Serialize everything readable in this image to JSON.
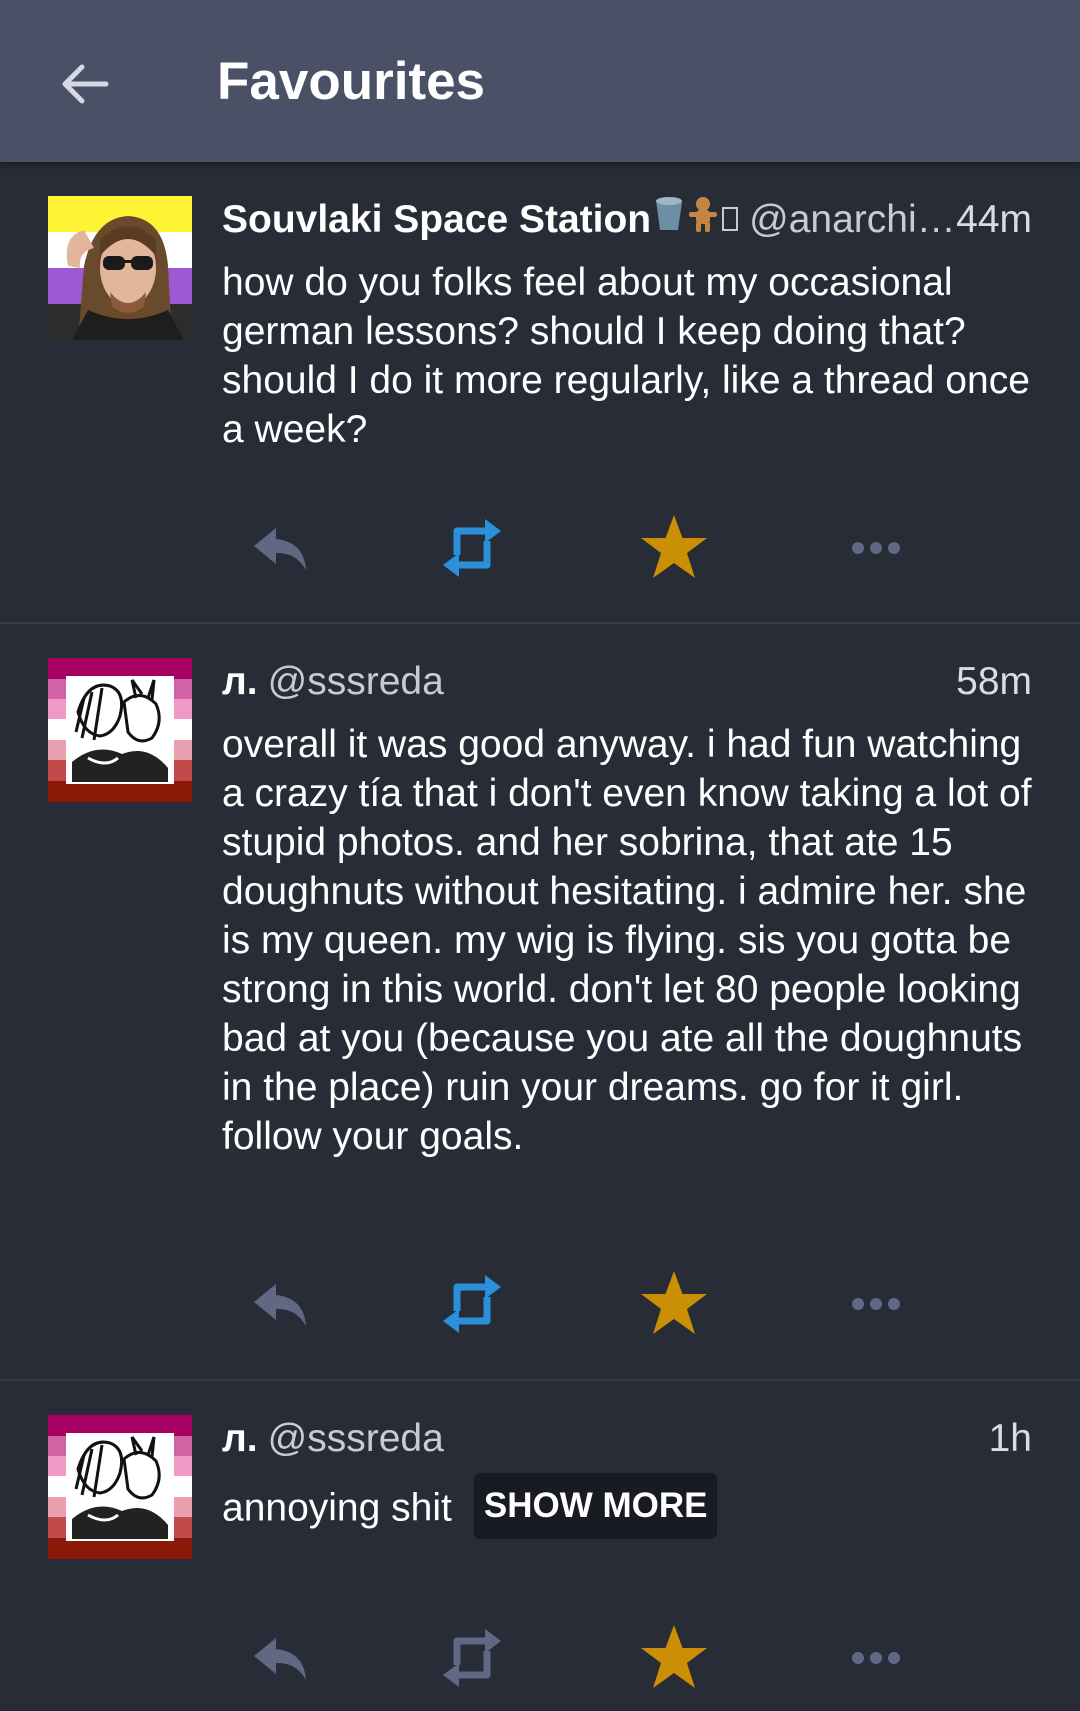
{
  "header": {
    "title": "Favourites"
  },
  "colors": {
    "topbar": "#4a5066",
    "background": "#282c37",
    "boost_active": "#2b90d9",
    "favourite_active": "#ca8f04",
    "icon_muted": "#606984"
  },
  "posts": [
    {
      "display_name": "Souvlaki Space Station",
      "name_emoji": [
        "bucket-emoji",
        "gingerbread-emoji",
        "box-glyph"
      ],
      "handle": "@anarchi…",
      "time": "44m",
      "content": "how do you folks feel about my occasional german lessons? should I keep doing that? should I do it more regularly, like a thread once a week?",
      "boosted": true,
      "favourited": true
    },
    {
      "display_name": "л.",
      "handle": "@sssreda",
      "time": "58m",
      "content": "overall it was good anyway. i had fun watching a crazy tía that i don't even know taking a lot of stupid photos. and her sobrina, that ate 15 doughnuts without hesitating. i admire her. she is my queen. my wig is flying. sis you gotta be strong in this world. don't let 80 people looking bad at you (because you ate all the doughnuts in the place) ruin your dreams. go for it girl. follow your goals.",
      "boosted": true,
      "favourited": true
    },
    {
      "display_name": "л.",
      "handle": "@sssreda",
      "time": "1h",
      "content": "annoying shit",
      "show_more_label": "SHOW MORE",
      "boosted": false,
      "favourited": true
    }
  ]
}
